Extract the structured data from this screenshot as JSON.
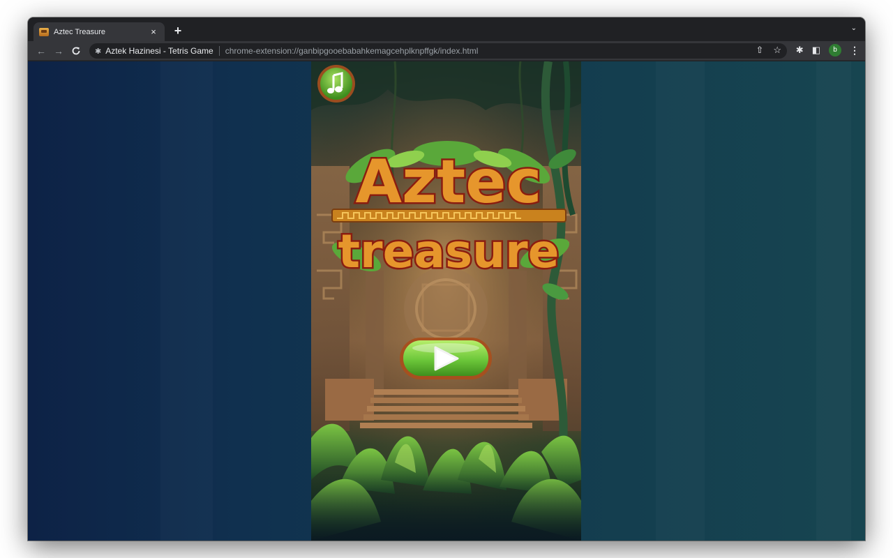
{
  "browser": {
    "tab": {
      "title": "Aztec Treasure",
      "close_glyph": "×",
      "favicon": "treasure-chest-icon"
    },
    "new_tab_glyph": "+",
    "tab_search_glyph": "⌄",
    "nav": {
      "back_glyph": "←",
      "forward_glyph": "→",
      "reload_glyph": "C"
    },
    "omnibox": {
      "site_name": "Aztek Hazinesi - Tetris Game",
      "url": "chrome-extension://ganbipgooebabahkemagcehplknpffgk/index.html",
      "share_glyph": "⇧",
      "star_glyph": "☆"
    },
    "toolbar_right": {
      "extensions_glyph": "✱",
      "sidepanel_glyph": "◧",
      "avatar_letter": "b",
      "menu_glyph": "⋮"
    }
  },
  "game": {
    "title_line1": "Aztec",
    "title_line2": "treasure",
    "music_icon": "music-note-icon",
    "play_icon": "play-icon",
    "colors": {
      "title_fill": "#e6962c",
      "title_stroke": "#8a1d10",
      "title_outline": "#fff4d6",
      "button_green": "#6cc73a",
      "button_border": "#a6501f"
    }
  }
}
